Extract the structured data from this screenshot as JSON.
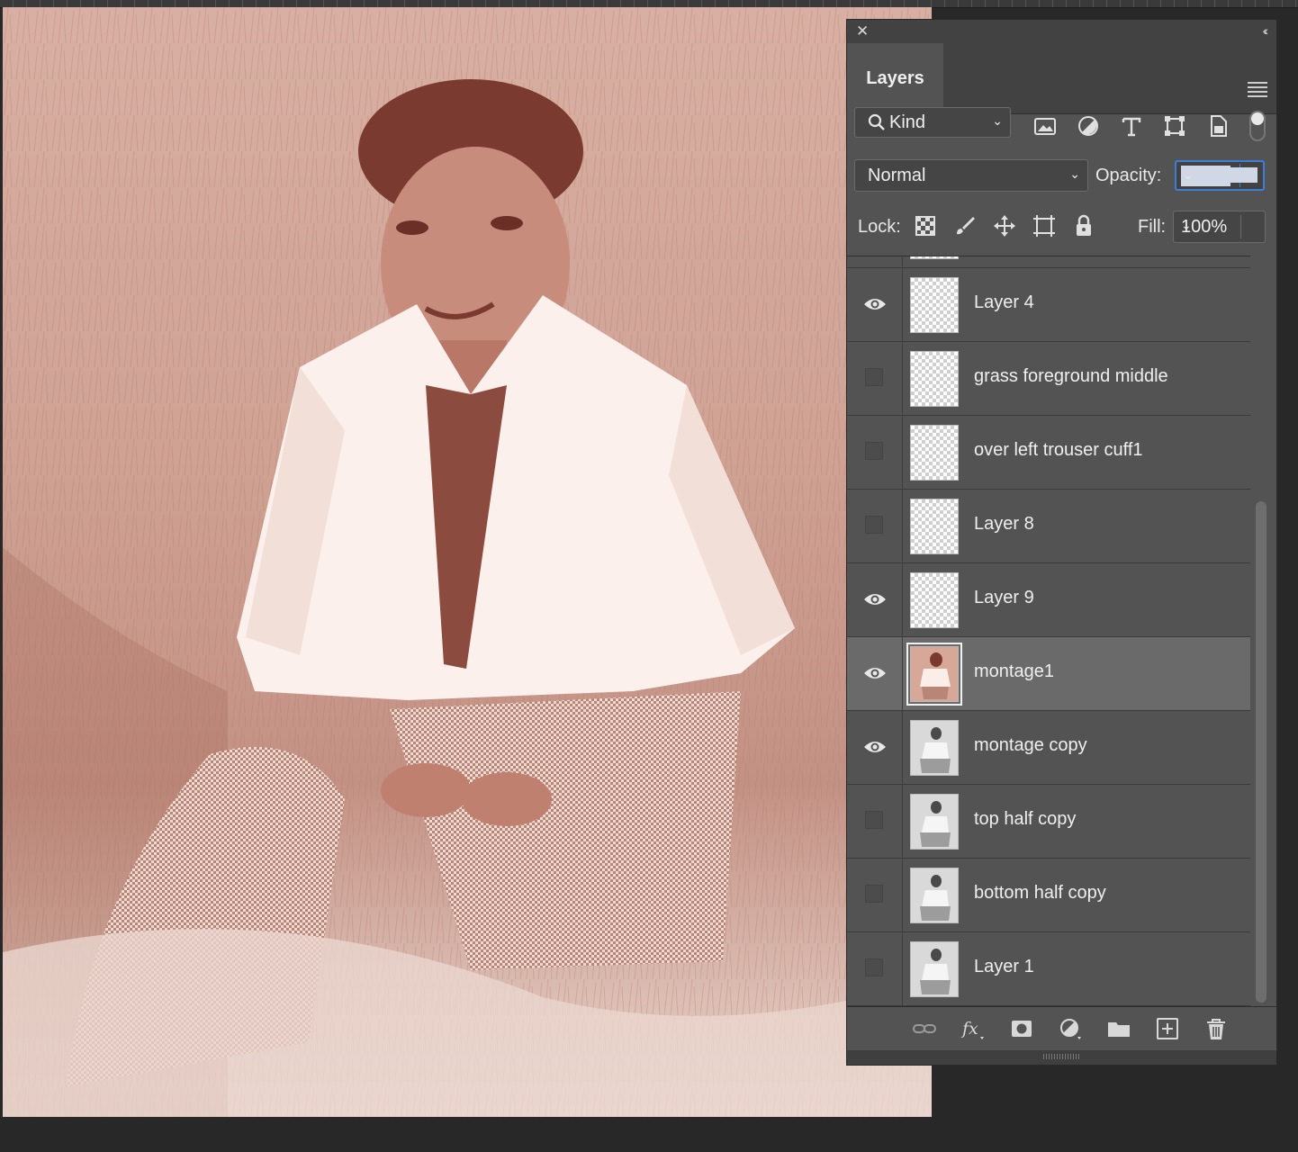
{
  "panel": {
    "close_glyph": "✕",
    "collapse_glyph": "‹‹",
    "tab_label": "Layers",
    "filter": {
      "kind_label": "Kind"
    },
    "blend_mode": "Normal",
    "opacity_label": "Opacity:",
    "opacity_value": "100%",
    "lock_label": "Lock:",
    "fill_label": "Fill:",
    "fill_value": "100%"
  },
  "layers": [
    {
      "name": "Layer 4",
      "visible": true,
      "thumb": "transparent"
    },
    {
      "name": "grass foreground middle",
      "visible": false,
      "thumb": "transparent"
    },
    {
      "name": "over left trouser cuff1",
      "visible": false,
      "thumb": "transparent"
    },
    {
      "name": "Layer 8",
      "visible": false,
      "thumb": "transparent"
    },
    {
      "name": "Layer 9",
      "visible": true,
      "thumb": "transparent"
    },
    {
      "name": "montage1",
      "visible": true,
      "thumb": "red-photo",
      "selected": true
    },
    {
      "name": "montage copy",
      "visible": true,
      "thumb": "photo"
    },
    {
      "name": "top half copy",
      "visible": false,
      "thumb": "photo"
    },
    {
      "name": "bottom half copy",
      "visible": false,
      "thumb": "photo"
    },
    {
      "name": "Layer 1",
      "visible": false,
      "thumb": "photo"
    }
  ],
  "icons": {
    "filter": [
      "image-filter-icon",
      "adjustment-filter-icon",
      "type-filter-icon",
      "shape-filter-icon",
      "smart-object-filter-icon"
    ],
    "lock": [
      "lock-transparent-icon",
      "lock-paint-icon",
      "lock-move-icon",
      "lock-artboard-icon",
      "lock-all-icon"
    ],
    "bottom": [
      "link-layers-icon",
      "fx-icon",
      "add-mask-icon",
      "new-adjustment-icon",
      "new-group-icon",
      "new-layer-icon",
      "delete-layer-icon"
    ]
  },
  "colors": {
    "panel_bg": "#535353",
    "selected_row": "#6a6a6a",
    "accent": "#3d7fd8"
  }
}
